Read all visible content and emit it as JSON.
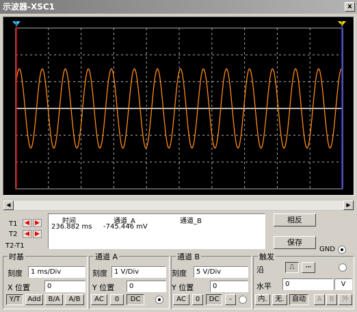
{
  "window": {
    "title": "示波器-XSC1",
    "close_label": "x"
  },
  "scope": {
    "background": "#000000",
    "grid_color": "#b0b0b0",
    "channel_a_color": "#ff8c1a",
    "channel_b_color": "#ffffff",
    "cursor1_color": "#e00000",
    "cursor2_color": "#2a2aff",
    "cursor1_marker": "1",
    "cursor2_marker": "2"
  },
  "readout": {
    "col_time": "时间",
    "col_a": "通道_A",
    "col_b": "通道_B",
    "t1_label": "T1",
    "t2_label": "T2",
    "t2t1_label": "T2-T1",
    "t1_time": "236.882 ms",
    "t1_a": "-745.446 mV",
    "t1_b": ""
  },
  "buttons": {
    "reverse": "相反",
    "save": "保存",
    "gnd": "GND"
  },
  "timebase": {
    "title": "时基",
    "scale_label": "刻度",
    "scale": "1 ms/Div",
    "xpos_label": "X 位置",
    "xpos": "0",
    "modes": [
      "Y/T",
      "Add",
      "B/A",
      "A/B"
    ]
  },
  "channel_a": {
    "title": "通道 A",
    "scale_label": "刻度",
    "scale": "1  V/Div",
    "ypos_label": "Y 位置",
    "ypos": "0",
    "coupling": [
      "AC",
      "0",
      "DC"
    ]
  },
  "channel_b": {
    "title": "通道 B",
    "scale_label": "刻度",
    "scale": "5  V/Div",
    "ypos_label": "Y 位置",
    "ypos": "0",
    "coupling": [
      "AC",
      "0",
      "DC",
      "-"
    ]
  },
  "trigger": {
    "title": "触发",
    "edge_label": "沿",
    "level_label": "水平",
    "level": "0",
    "level_unit": "V",
    "modes": [
      "内.",
      "无.",
      "自动"
    ],
    "sources": [
      "A",
      "B",
      "外"
    ]
  }
}
